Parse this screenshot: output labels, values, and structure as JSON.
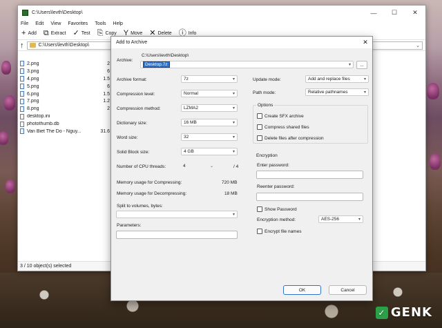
{
  "window": {
    "title": "C:\\Users\\levth\\Desktop\\",
    "minimize_glyph": "—",
    "maximize_glyph": "☐",
    "close_glyph": "✕"
  },
  "menu": [
    "File",
    "Edit",
    "View",
    "Favorites",
    "Tools",
    "Help"
  ],
  "toolbar": {
    "add": "Add",
    "extract": "Extract",
    "test": "Test",
    "copy": "Copy",
    "move": "Move",
    "delete": "Delete",
    "info": "Info"
  },
  "address": {
    "path": "C:\\Users\\levth\\Desktop\\"
  },
  "files": [
    {
      "name": "2.png",
      "size": "2"
    },
    {
      "name": "3.png",
      "size": "6"
    },
    {
      "name": "4.png",
      "size": "1.5"
    },
    {
      "name": "5.png",
      "size": "6"
    },
    {
      "name": "6.png",
      "size": "1.5"
    },
    {
      "name": "7.png",
      "size": "1.2"
    },
    {
      "name": "8.png",
      "size": "2"
    },
    {
      "name": "desktop.ini",
      "size": ""
    },
    {
      "name": "photothumb.db",
      "size": ""
    },
    {
      "name": "Van Biet The Do - Nguy...",
      "size": "31.6"
    }
  ],
  "status": {
    "text": "3 / 10 object(s) selected"
  },
  "dialog": {
    "title": "Add to Archive",
    "archive_label": "Archive:",
    "archive_path": "C:\\Users\\levth\\Desktop\\",
    "archive_name": "Desktop.7z",
    "browse": "...",
    "archive_format_label": "Archive format:",
    "archive_format": "7z",
    "compression_level_label": "Compression level:",
    "compression_level": "Normal",
    "compression_method_label": "Compression method:",
    "compression_method": "LZMA2",
    "dictionary_size_label": "Dictionary size:",
    "dictionary_size": "16 MB",
    "word_size_label": "Word size:",
    "word_size": "32",
    "solid_block_label": "Solid Block size:",
    "solid_block": "4 GB",
    "cpu_threads_label": "Number of CPU threads:",
    "cpu_threads": "4",
    "cpu_threads_max": "/ 4",
    "mem_compress_label": "Memory usage for Compressing:",
    "mem_compress": "720 MB",
    "mem_decompress_label": "Memory usage for Decompressing:",
    "mem_decompress": "18 MB",
    "split_label": "Split to volumes, bytes:",
    "parameters_label": "Parameters:",
    "update_mode_label": "Update mode:",
    "update_mode": "Add and replace files",
    "path_mode_label": "Path mode:",
    "path_mode": "Relative pathnames",
    "options_label": "Options",
    "create_sfx": "Create SFX archive",
    "compress_shared": "Compress shared files",
    "delete_after": "Delete files after compression",
    "encryption_label": "Encryption",
    "enter_password_label": "Enter password:",
    "reenter_password_label": "Reenter password:",
    "show_password": "Show Password",
    "encryption_method_label": "Encryption method:",
    "encryption_method": "AES-256",
    "encrypt_names": "Encrypt file names",
    "ok": "OK",
    "cancel": "Cancel"
  },
  "watermark": {
    "text": "GENK"
  }
}
